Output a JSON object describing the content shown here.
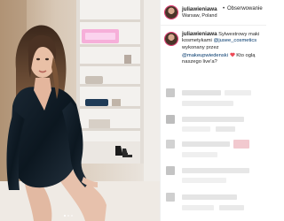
{
  "post": {
    "username": "juliawieniawa",
    "separator": "•",
    "follow_label": "Obserwowanie",
    "location": "Warsaw, Poland"
  },
  "caption": {
    "username": "juliawieniawa",
    "line1_text": "Sylwestrowy maki",
    "line2_text": "kosmetykami",
    "line2_mention": "@jusee_cosmetics",
    "line3_text": "wykonany przez",
    "line4_mention": "@makeupwiedenski",
    "line4_tail": "Kto oglą",
    "line5_text": "naszego live'a?"
  },
  "colors": {
    "story_ring": "#e1306c",
    "mention": "#00376b",
    "heart": "#ed4956"
  },
  "icons": {
    "heart": "heart-icon",
    "avatar": "avatar"
  }
}
